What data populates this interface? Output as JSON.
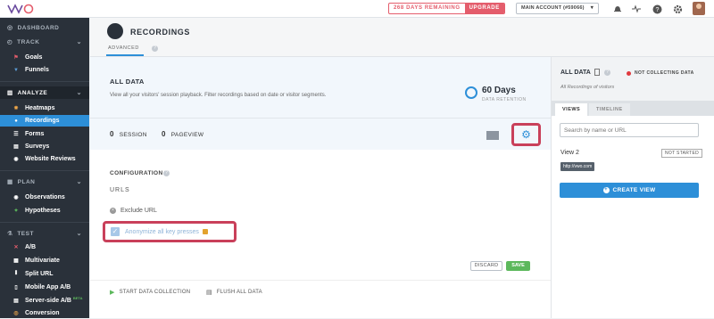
{
  "topbar": {
    "logo_text": "VWO",
    "trial_days": "268 DAYS REMAINING",
    "upgrade_label": "UPGRADE",
    "account_label": "MAIN ACCOUNT (#59066)",
    "icons": [
      "bell-icon",
      "pulse-icon",
      "help-icon",
      "gear-icon",
      "avatar"
    ]
  },
  "sidebar": {
    "dashboard": "DASHBOARD",
    "track": "TRACK",
    "track_items": [
      "Goals",
      "Funnels"
    ],
    "analyze": "ANALYZE",
    "analyze_items": [
      "Heatmaps",
      "Recordings",
      "Forms",
      "Surveys",
      "Website Reviews"
    ],
    "plan": "PLAN",
    "plan_items": [
      "Observations",
      "Hypotheses"
    ],
    "test": "TEST",
    "test_items": [
      "A/B",
      "Multivariate",
      "Split URL",
      "Mobile App A/B",
      "Server-side A/B",
      "Conversion"
    ],
    "beta_label": "BETA"
  },
  "header": {
    "title": "RECORDINGS",
    "tab_advanced": "ADVANCED"
  },
  "main": {
    "all_data_title": "ALL DATA",
    "all_data_desc": "View all your visitors' session playback. Filter recordings based on date or visitor segments.",
    "retention_value": "60 Days",
    "retention_label": "DATA RETENTION",
    "session_count": "0",
    "session_label": "SESSION",
    "pageview_count": "0",
    "pageview_label": "PAGEVIEW",
    "configuration_label": "CONFIGURATION",
    "urls_label": "URLS",
    "exclude_url_label": "Exclude URL",
    "anonymize_label": "Anonymize all key presses",
    "discard_label": "DISCARD",
    "save_label": "SAVE",
    "start_label": "START DATA COLLECTION",
    "flush_label": "FLUSH ALL DATA"
  },
  "right_panel": {
    "title": "ALL DATA",
    "status": "NOT COLLECTING DATA",
    "subtitle": "All Recordings of visitors",
    "tab_views": "VIEWS",
    "tab_timeline": "TIMELINE",
    "search_placeholder": "Search by name or URL",
    "view_name": "View 2",
    "view_status": "NOT STARTED",
    "view_url": "http://vwo.com",
    "create_label": "CREATE VIEW"
  },
  "colors": {
    "accent": "#2d8fd8",
    "sidebar_bg": "#2a313a",
    "alert": "#e45d6c",
    "highlight": "#c9405a",
    "save": "#5cb85c"
  }
}
